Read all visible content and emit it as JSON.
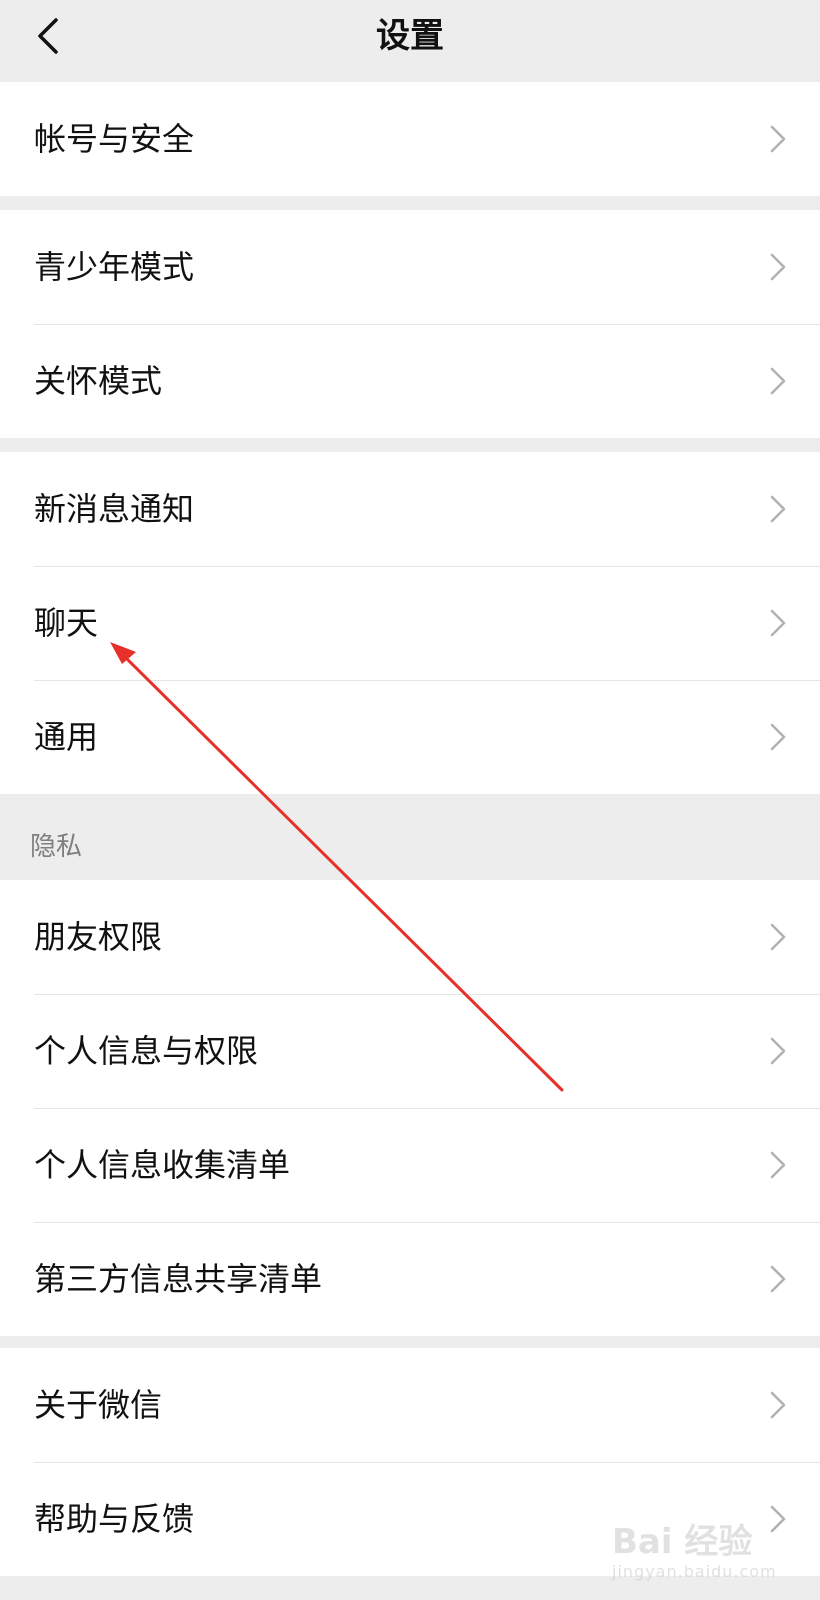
{
  "header": {
    "title": "设置",
    "back_icon": "chevron-left-icon"
  },
  "groups": [
    {
      "items": [
        {
          "label": "帐号与安全"
        }
      ]
    },
    {
      "items": [
        {
          "label": "青少年模式"
        },
        {
          "label": "关怀模式"
        }
      ]
    },
    {
      "items": [
        {
          "label": "新消息通知"
        },
        {
          "label": "聊天"
        },
        {
          "label": "通用"
        }
      ]
    },
    {
      "section_title": "隐私",
      "items": [
        {
          "label": "朋友权限"
        },
        {
          "label": "个人信息与权限"
        },
        {
          "label": "个人信息收集清单"
        },
        {
          "label": "第三方信息共享清单"
        }
      ]
    },
    {
      "items": [
        {
          "label": "关于微信"
        },
        {
          "label": "帮助与反馈"
        }
      ]
    }
  ],
  "row_icon": "chevron-right-icon",
  "annotation": {
    "color": "#e8302a",
    "points_to": "聊天"
  },
  "watermark": {
    "text": "Bai 经验",
    "sub": "jingyan.baidu.com"
  },
  "colors": {
    "background": "#ededed",
    "card": "#ffffff",
    "divider": "#e5e5e5",
    "text": "#111111",
    "section_text": "#7f7f7f",
    "chevron": "#b2b2b2"
  }
}
